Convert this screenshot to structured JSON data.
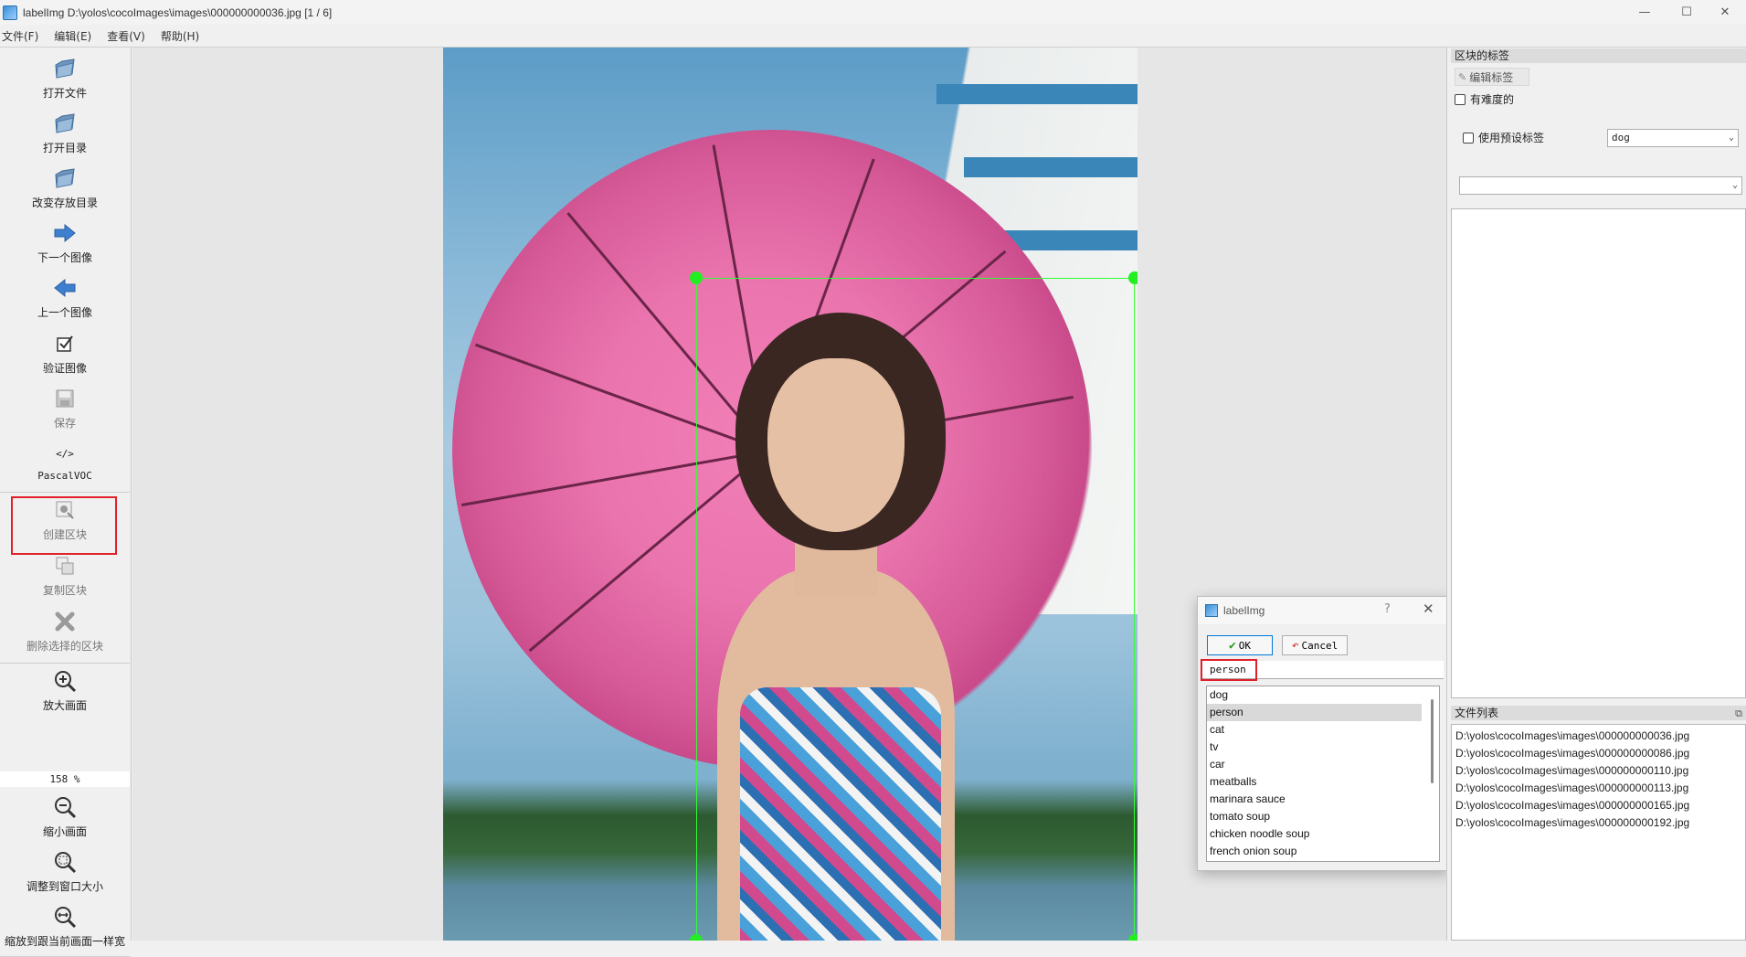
{
  "window": {
    "title": "labelImg D:\\yolos\\cocoImages\\images\\000000000036.jpg [1 / 6]",
    "controls": [
      "—",
      "☐",
      "✕"
    ]
  },
  "menu": [
    "文件(F)",
    "编辑(E)",
    "查看(V)",
    "帮助(H)"
  ],
  "toolbar": {
    "open_file": "打开文件",
    "open_dir": "打开目录",
    "change_save_dir": "改变存放目录",
    "next_image": "下一个图像",
    "prev_image": "上一个图像",
    "verify_image": "验证图像",
    "save": "保存",
    "format": "PascalVOC",
    "create_box": "创建区块",
    "duplicate_box": "复制区块",
    "delete_box": "删除选择的区块",
    "zoom_in": "放大画面",
    "zoom_level": "158 %",
    "zoom_out": "缩小画面",
    "fit_window": "调整到窗口大小",
    "fit_width": "缩放到跟当前画面一样宽",
    "format_icon": "</>"
  },
  "dialog": {
    "title": "labelImg",
    "help": "?",
    "close": "✕",
    "ok": "OK",
    "cancel": "Cancel",
    "input_value": "person",
    "items": [
      "dog",
      "person",
      "cat",
      "tv",
      "car",
      "meatballs",
      "marinara sauce",
      "tomato soup",
      "chicken noodle soup",
      "french onion soup"
    ],
    "selected_index": 1
  },
  "right_panel": {
    "box_labels_title": "区块的标签",
    "edit_label": "编辑标签",
    "difficult": "有难度的",
    "use_default_label": "使用预设标签",
    "default_label_value": "dog",
    "label_filter_value": "",
    "file_list_title": "文件列表",
    "files": [
      "D:\\yolos\\cocoImages\\images\\000000000036.jpg",
      "D:\\yolos\\cocoImages\\images\\000000000086.jpg",
      "D:\\yolos\\cocoImages\\images\\000000000110.jpg",
      "D:\\yolos\\cocoImages\\images\\000000000113.jpg",
      "D:\\yolos\\cocoImages\\images\\000000000165.jpg",
      "D:\\yolos\\cocoImages\\images\\000000000192.jpg"
    ]
  },
  "colors": {
    "highlight": "#e0202a",
    "bbox": "#33ff33",
    "handle": "#22ee22"
  }
}
